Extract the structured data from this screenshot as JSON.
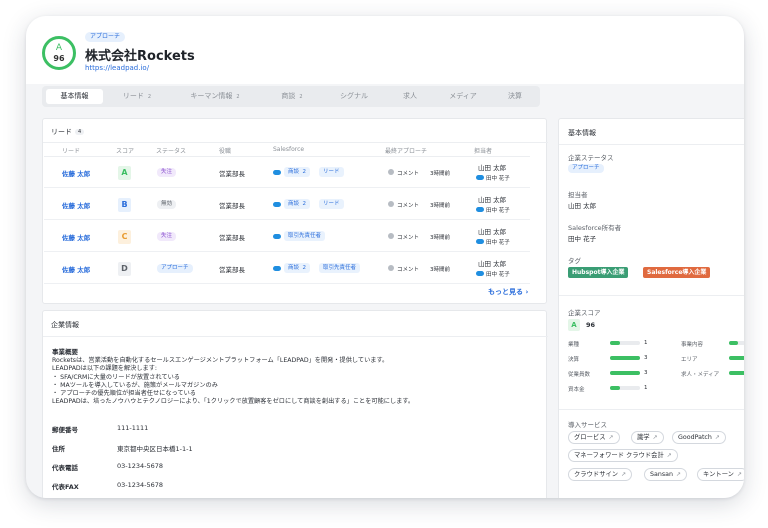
{
  "header": {
    "grade": "A",
    "score": "96",
    "badge": "アプローチ",
    "company": "株式会社Rockets",
    "url": "https://leadpad.io/"
  },
  "tabs": [
    {
      "label": "基本情報",
      "count": "",
      "active": true
    },
    {
      "label": "リード",
      "count": "2"
    },
    {
      "label": "キーマン情報",
      "count": "2"
    },
    {
      "label": "商談",
      "count": "2"
    },
    {
      "label": "シグナル",
      "count": ""
    },
    {
      "label": "求人",
      "count": ""
    },
    {
      "label": "メディア",
      "count": ""
    },
    {
      "label": "決算",
      "count": ""
    }
  ],
  "leads": {
    "title": "リード",
    "count": "4",
    "headers": {
      "lead": "リード",
      "score": "スコア",
      "status": "ステータス",
      "role": "役職",
      "salesforce": "Salesforce",
      "last": "最終アプローチ",
      "owner": "担当者"
    },
    "rows": [
      {
        "name": "佐藤 太郎",
        "grade": "A",
        "status": "失注",
        "role": "営業部長",
        "sf": "商談",
        "sf_count": "2",
        "sf2": "リード",
        "approach": "コメント",
        "ago": "3時間前",
        "owner": "山田 太郎",
        "owner2": "田中 花子"
      },
      {
        "name": "佐藤 太郎",
        "grade": "B",
        "status": "無効",
        "role": "営業部長",
        "sf": "商談",
        "sf_count": "2",
        "sf2": "リード",
        "approach": "コメント",
        "ago": "3時間前",
        "owner": "山田 太郎",
        "owner2": "田中 花子"
      },
      {
        "name": "佐藤 太郎",
        "grade": "C",
        "status": "失注",
        "role": "営業部長",
        "sf": "取引先責任者",
        "sf_count": "",
        "sf2": "",
        "approach": "コメント",
        "ago": "3時間前",
        "owner": "山田 太郎",
        "owner2": "田中 花子"
      },
      {
        "name": "佐藤 太郎",
        "grade": "D",
        "status": "アプローチ",
        "role": "営業部長",
        "sf": "商談",
        "sf_count": "2",
        "sf2": "取引先責任者",
        "approach": "コメント",
        "ago": "3時間前",
        "owner": "山田 太郎",
        "owner2": "田中 花子"
      }
    ],
    "more": "もっと見る"
  },
  "company_info": {
    "title": "企業情報",
    "overview_label": "事業概要",
    "overview_lines": [
      "Rocketsは、営業活動を自動化するセールスエンゲージメントプラットフォーム「LEADPAD」を開発・提供しています。",
      "LEADPADは以下の課題を解決します:",
      "・ SFA/CRMに大量のリードが放置されている",
      "・ MAツールを導入しているが、施策がメールマガジンのみ",
      "・ アプローチの優先順位が担当者任せになっている",
      "LEADPADは、培ったノウハウとテクノロジーにより、「1クリックで放置顧客をゼロにして商談を創出する」ことを可能にします。"
    ],
    "postal_label": "郵便番号",
    "postal": "111-1111",
    "address_label": "住所",
    "address": "東京都中央区日本橋1-1-1",
    "phone_label": "代表電話",
    "phone": "03-1234-5678",
    "fax_label": "代表FAX",
    "fax": "03-1234-5678"
  },
  "basic": {
    "title": "基本情報",
    "status_label": "企業ステータス",
    "status": "アプローチ",
    "owner_label": "担当者",
    "owner": "山田 太郎",
    "sf_owner_label": "Salesforce所有者",
    "sf_owner": "田中 花子",
    "tag_label": "タグ",
    "tags": [
      {
        "label": "Hubspot導入企業",
        "color": "#3a9d74"
      },
      {
        "label": "Salesforce導入企業",
        "color": "#e06a3f"
      }
    ],
    "score_label": "企業スコア",
    "score_grade": "A",
    "score": "96",
    "metrics_left": [
      {
        "label": "業種",
        "value": "1",
        "level": 0.33
      },
      {
        "label": "決算",
        "value": "3",
        "level": 1.0
      },
      {
        "label": "従業員数",
        "value": "3",
        "level": 1.0
      },
      {
        "label": "資本金",
        "value": "1",
        "level": 0.33
      }
    ],
    "metrics_right": [
      {
        "label": "事業内容",
        "level": 0.33
      },
      {
        "label": "エリア",
        "level": 0.66
      },
      {
        "label": "求人・メディア",
        "level": 1.0
      }
    ],
    "services_label": "導入サービス",
    "services": [
      "グロービス",
      "識学",
      "GoodPatch",
      "マネーフォワード クラウド会計",
      "クラウドサイン",
      "Sansan",
      "キントーン"
    ]
  }
}
